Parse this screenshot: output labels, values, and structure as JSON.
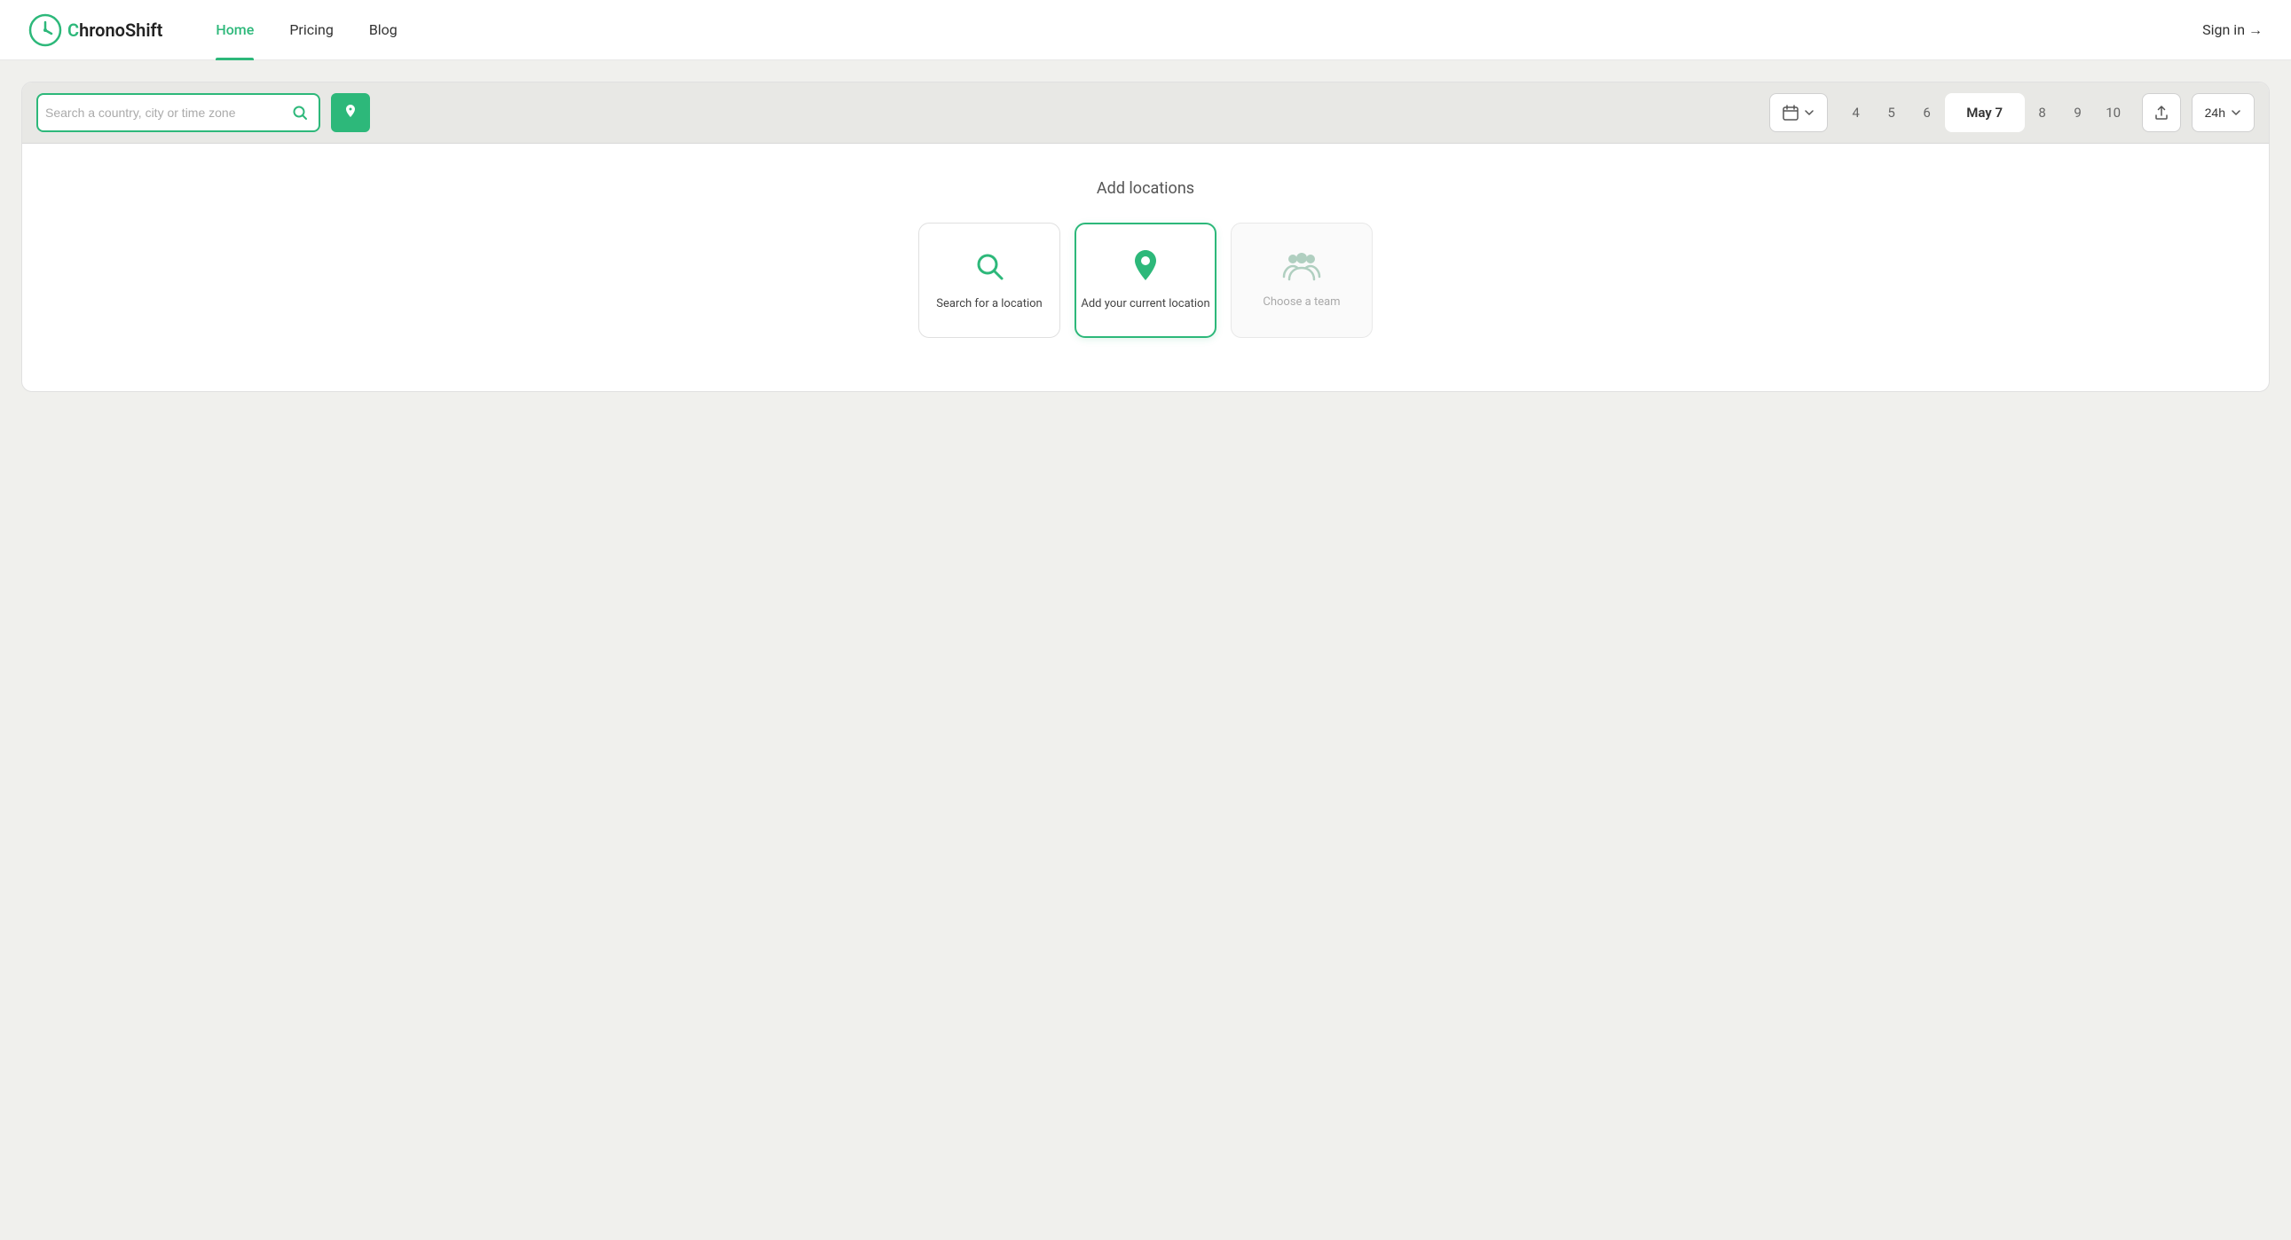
{
  "nav": {
    "logo_text_prefix": "C",
    "logo_text_main": "hronoShift",
    "links": [
      {
        "id": "home",
        "label": "Home",
        "active": true
      },
      {
        "id": "pricing",
        "label": "Pricing",
        "active": false
      },
      {
        "id": "blog",
        "label": "Blog",
        "active": false
      }
    ],
    "sign_in_label": "Sign in →"
  },
  "toolbar": {
    "search_placeholder": "Search a country, city or time zone",
    "calendar_label": "📅",
    "dates": [
      {
        "value": "4",
        "active": false
      },
      {
        "value": "5",
        "active": false
      },
      {
        "value": "6",
        "active": false
      },
      {
        "value": "May 7",
        "active": true
      },
      {
        "value": "8",
        "active": false
      },
      {
        "value": "9",
        "active": false
      },
      {
        "value": "10",
        "active": false
      }
    ],
    "time_format": "24h"
  },
  "main": {
    "add_locations_title": "Add locations",
    "cards": [
      {
        "id": "search",
        "label": "Search for a location",
        "icon_type": "search",
        "disabled": false,
        "active": false
      },
      {
        "id": "current",
        "label": "Add your current location",
        "icon_type": "pin",
        "disabled": false,
        "active": true
      },
      {
        "id": "team",
        "label": "Choose a team",
        "icon_type": "team",
        "disabled": true,
        "active": false
      }
    ]
  }
}
